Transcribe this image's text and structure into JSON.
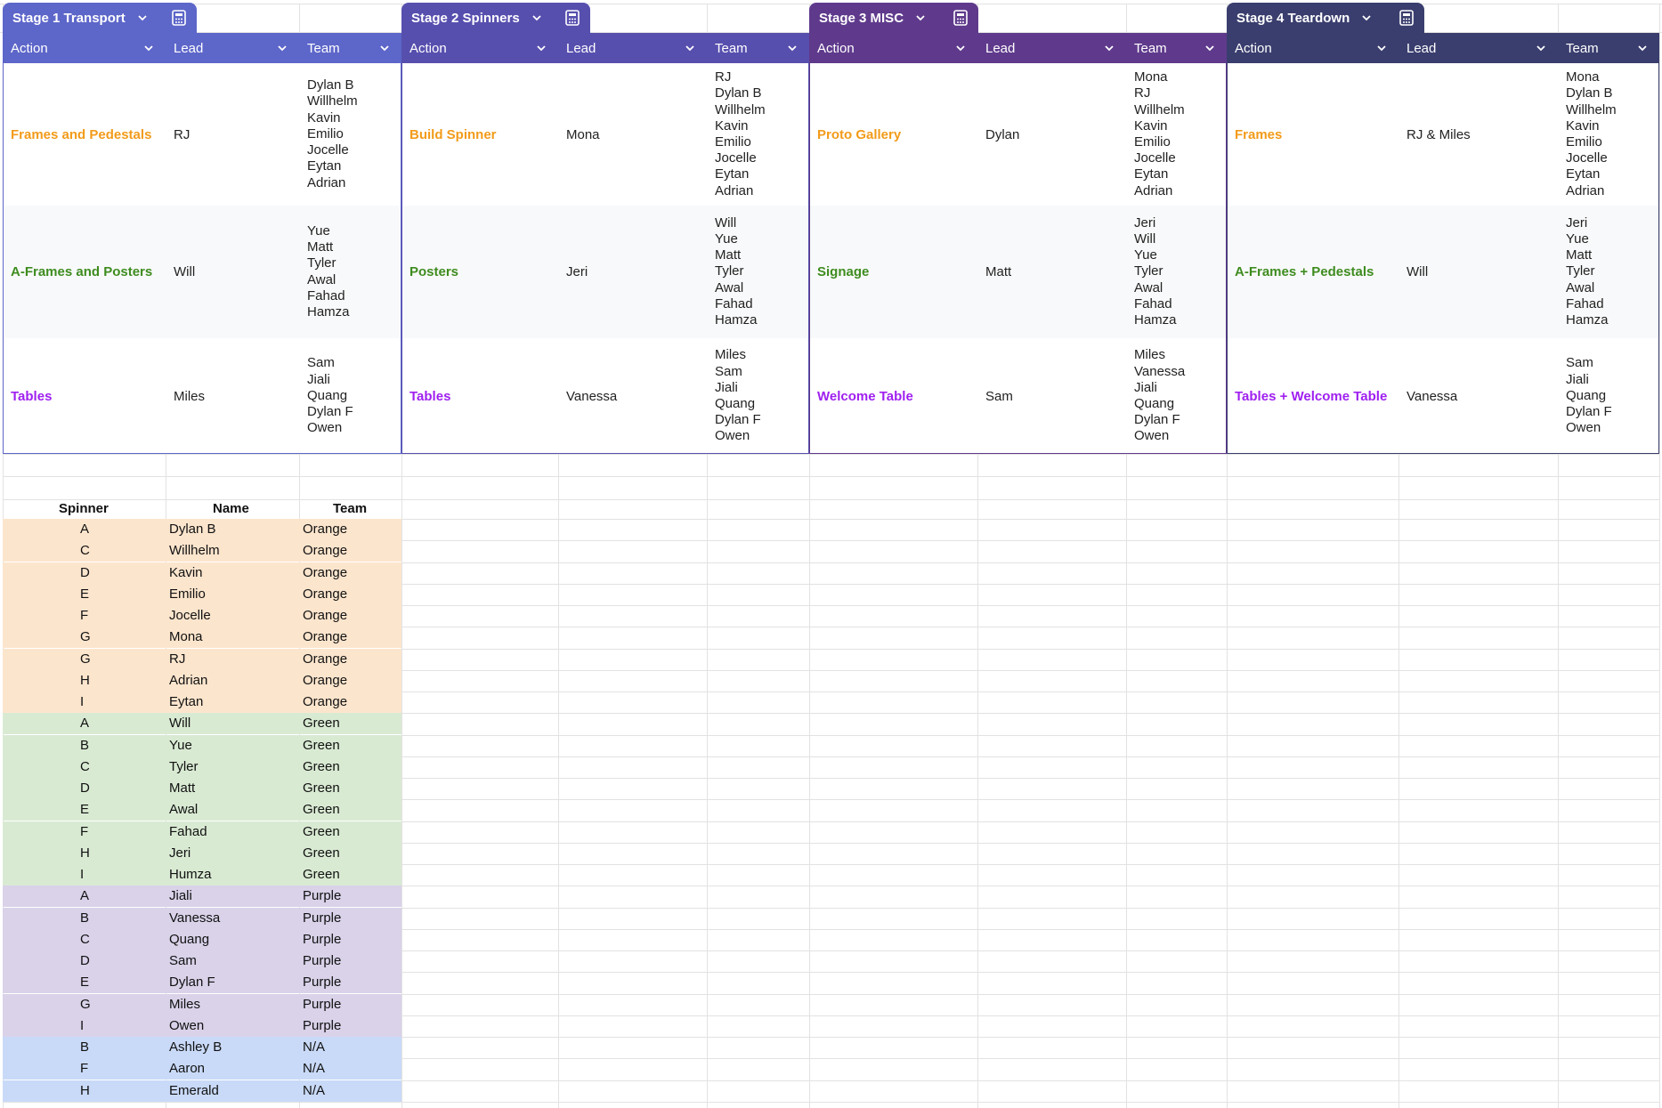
{
  "colors": {
    "stage1": "#5d66c9",
    "stage2": "#574fae",
    "stage3": "#5f3a8c",
    "stage4": "#3a3e6e",
    "orange_text": "#f29b1a",
    "green_text": "#3e8c1f",
    "purple_text": "#a020f0",
    "orange_bg": "#fce5cd",
    "green_bg": "#d9ead3",
    "purple_bg": "#d9d2e9",
    "blue_bg": "#c9daf8"
  },
  "stages": [
    {
      "tab": "Stage 1 Transport",
      "headers": [
        "Action",
        "Lead",
        "Team"
      ],
      "rows": [
        {
          "action": "Frames and Pedestals",
          "lead": "RJ",
          "team": "Dylan B\nWillhelm\nKavin\nEmilio\nJocelle\nEytan\nAdrian"
        },
        {
          "action": "A-Frames and Posters",
          "lead": "Will",
          "team": "Yue\nMatt\nTyler\nAwal\nFahad\nHamza"
        },
        {
          "action": "Tables",
          "lead": "Miles",
          "team": "Sam\nJiali\nQuang\nDylan F\nOwen"
        }
      ]
    },
    {
      "tab": "Stage 2 Spinners",
      "headers": [
        "Action",
        "Lead",
        "Team"
      ],
      "rows": [
        {
          "action": "Build Spinner",
          "lead": "Mona",
          "team": "RJ\nDylan B\nWillhelm\nKavin\nEmilio\nJocelle\nEytan\nAdrian"
        },
        {
          "action": "Posters",
          "lead": "Jeri",
          "team": "Will\nYue\nMatt\nTyler\nAwal\nFahad\nHamza"
        },
        {
          "action": "Tables",
          "lead": "Vanessa",
          "team": "Miles\nSam\nJiali\nQuang\nDylan F\nOwen"
        }
      ]
    },
    {
      "tab": "Stage 3 MISC",
      "headers": [
        "Action",
        "Lead",
        "Team"
      ],
      "rows": [
        {
          "action": "Proto Gallery",
          "lead": "Dylan",
          "team": "Mona\nRJ\nWillhelm\nKavin\nEmilio\nJocelle\nEytan\nAdrian"
        },
        {
          "action": "Signage",
          "lead": "Matt",
          "team": "Jeri\nWill\nYue\nTyler\nAwal\nFahad\nHamza"
        },
        {
          "action": "Welcome Table",
          "lead": "Sam",
          "team": "Miles\nVanessa\nJiali\nQuang\nDylan F\nOwen"
        }
      ]
    },
    {
      "tab": "Stage 4 Teardown",
      "headers": [
        "Action",
        "Lead",
        "Team"
      ],
      "rows": [
        {
          "action": "Frames",
          "lead": "RJ & Miles",
          "team": "Mona\nDylan B\nWillhelm\nKavin\nEmilio\nJocelle\nEytan\nAdrian"
        },
        {
          "action": "A-Frames + Pedestals",
          "lead": "Will",
          "team": "Jeri\nYue\nMatt\nTyler\nAwal\nFahad\nHamza"
        },
        {
          "action": "Tables + Welcome Table",
          "lead": "Vanessa",
          "team": "Sam\nJiali\nQuang\nDylan F\nOwen"
        }
      ]
    }
  ],
  "spinner_table": {
    "headers": [
      "Spinner",
      "Name",
      "Team"
    ],
    "rows": [
      {
        "spinner": "A",
        "name": "Dylan B",
        "team": "Orange"
      },
      {
        "spinner": "C",
        "name": "Willhelm",
        "team": "Orange"
      },
      {
        "spinner": "D",
        "name": "Kavin",
        "team": "Orange"
      },
      {
        "spinner": "E",
        "name": "Emilio",
        "team": "Orange"
      },
      {
        "spinner": "F",
        "name": "Jocelle",
        "team": "Orange"
      },
      {
        "spinner": "G",
        "name": "Mona",
        "team": "Orange"
      },
      {
        "spinner": "G",
        "name": "RJ",
        "team": "Orange"
      },
      {
        "spinner": "H",
        "name": "Adrian",
        "team": "Orange"
      },
      {
        "spinner": "I",
        "name": "Eytan",
        "team": "Orange"
      },
      {
        "spinner": "A",
        "name": "Will",
        "team": "Green"
      },
      {
        "spinner": "B",
        "name": "Yue",
        "team": "Green"
      },
      {
        "spinner": "C",
        "name": "Tyler",
        "team": "Green"
      },
      {
        "spinner": "D",
        "name": "Matt",
        "team": "Green"
      },
      {
        "spinner": "E",
        "name": "Awal",
        "team": "Green"
      },
      {
        "spinner": "F",
        "name": "Fahad",
        "team": "Green"
      },
      {
        "spinner": "H",
        "name": "Jeri",
        "team": "Green"
      },
      {
        "spinner": "I",
        "name": "Humza",
        "team": "Green"
      },
      {
        "spinner": "A",
        "name": "Jiali",
        "team": "Purple"
      },
      {
        "spinner": "B",
        "name": "Vanessa",
        "team": "Purple"
      },
      {
        "spinner": "C",
        "name": "Quang",
        "team": "Purple"
      },
      {
        "spinner": "D",
        "name": "Sam",
        "team": "Purple"
      },
      {
        "spinner": "E",
        "name": "Dylan F",
        "team": "Purple"
      },
      {
        "spinner": "G",
        "name": "Miles",
        "team": "Purple"
      },
      {
        "spinner": "I",
        "name": "Owen",
        "team": "Purple"
      },
      {
        "spinner": "B",
        "name": "Ashley B",
        "team": "N/A"
      },
      {
        "spinner": "F",
        "name": "Aaron",
        "team": "N/A"
      },
      {
        "spinner": "H",
        "name": "Emerald",
        "team": "N/A"
      }
    ]
  }
}
